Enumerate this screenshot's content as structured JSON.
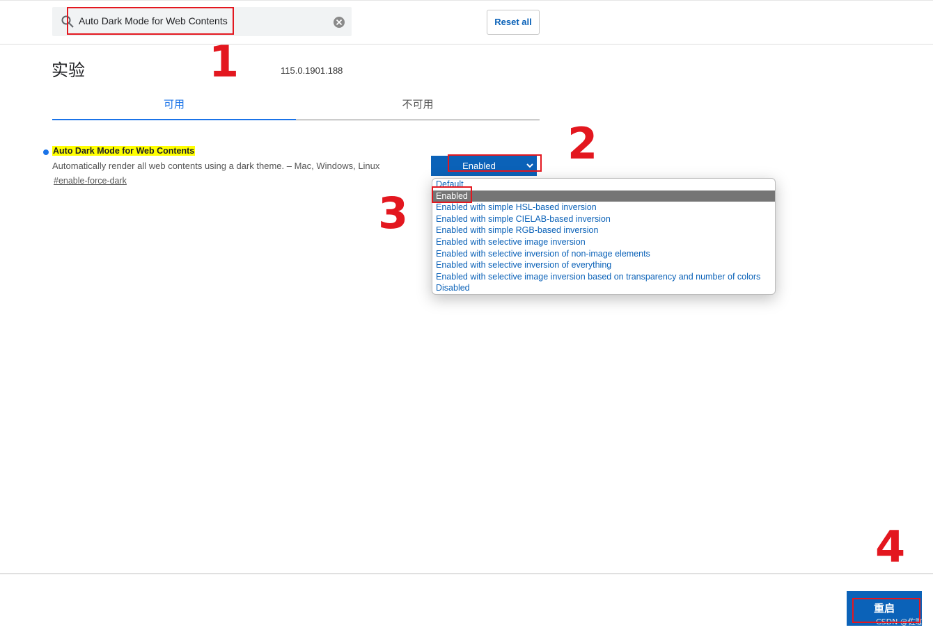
{
  "search": {
    "value": "Auto Dark Mode for Web Contents",
    "icon": "search-icon",
    "clear_icon": "clear-icon"
  },
  "header": {
    "reset_label": "Reset all"
  },
  "page": {
    "title": "实验",
    "version": "115.0.1901.188"
  },
  "tabs": [
    {
      "label": "可用",
      "active": true
    },
    {
      "label": "不可用",
      "active": false
    }
  ],
  "experiment": {
    "title": "Auto Dark Mode for Web Contents",
    "description": "Automatically render all web contents using a dark theme. – Mac, Windows, Linux",
    "link": "#enable-force-dark",
    "selected": "Enabled",
    "options": [
      "Default",
      "Enabled",
      "Enabled with simple HSL-based inversion",
      "Enabled with simple CIELAB-based inversion",
      "Enabled with simple RGB-based inversion",
      "Enabled with selective image inversion",
      "Enabled with selective inversion of non-image elements",
      "Enabled with selective inversion of everything",
      "Enabled with selective image inversion based on transparency and number of colors",
      "Disabled"
    ]
  },
  "footer": {
    "restart_label": "重启"
  },
  "annotations": {
    "step1": "1",
    "step2": "2",
    "step3": "3",
    "step4": "4"
  },
  "watermark": "CSDN @佐咖",
  "colors": {
    "accent": "#0b62b8",
    "highlight": "#ffff00",
    "annotation": "#e3171f"
  }
}
